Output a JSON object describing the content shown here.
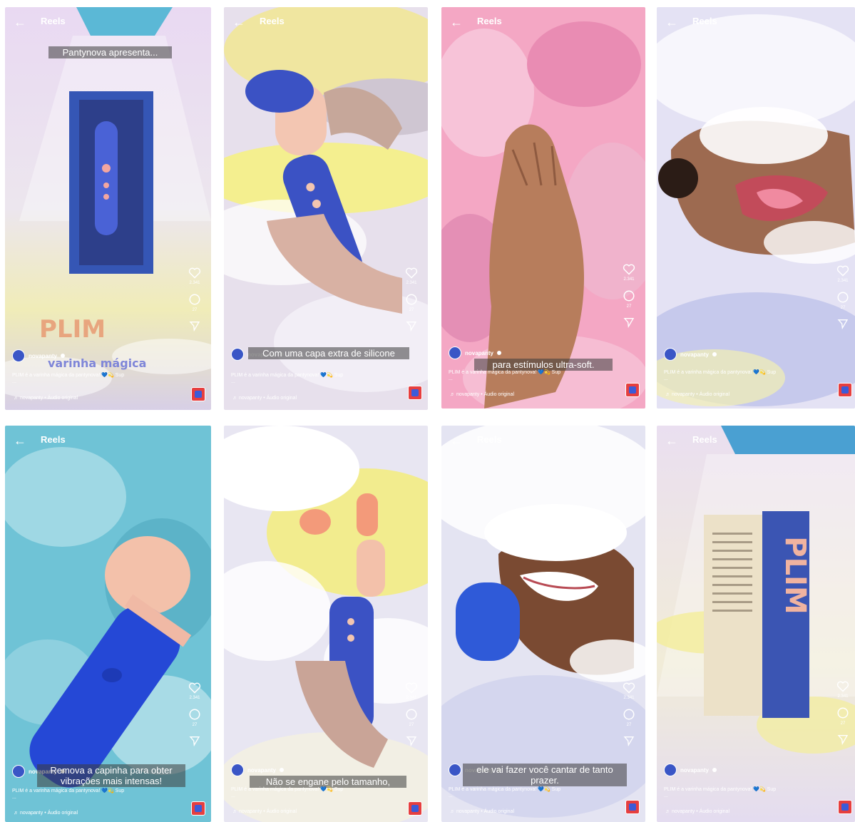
{
  "common": {
    "back_glyph": "←",
    "reels_label": "Reels",
    "username": "novapanty",
    "caption": "PLIM é a varinha mágica da pantynova! 💙💫 Sup",
    "caption_more": "...",
    "audio": "♬ novapanty • Áudio original",
    "likes": "2.341",
    "comments": "27"
  },
  "panels": [
    {
      "subtitle": "Pantynova apresenta...",
      "title_text": "PLIM",
      "subtitle2": "varinha mágica"
    },
    {
      "subtitle": "Com uma capa extra de silicone"
    },
    {
      "subtitle": "para estímulos ultra-soft."
    },
    {
      "subtitle": ""
    },
    {
      "subtitle": "Remova a capinha para obter vibrações mais intensas!"
    },
    {
      "subtitle": "Não se engane pelo tamanho,"
    },
    {
      "subtitle": "ele vai fazer você cantar de tanto prazer."
    },
    {
      "subtitle": "",
      "box_text": "PLIM"
    }
  ],
  "colors": {
    "ig_red": "#e63f3f",
    "product_blue": "#3b5bd8",
    "peach": "#f3c1aa"
  }
}
